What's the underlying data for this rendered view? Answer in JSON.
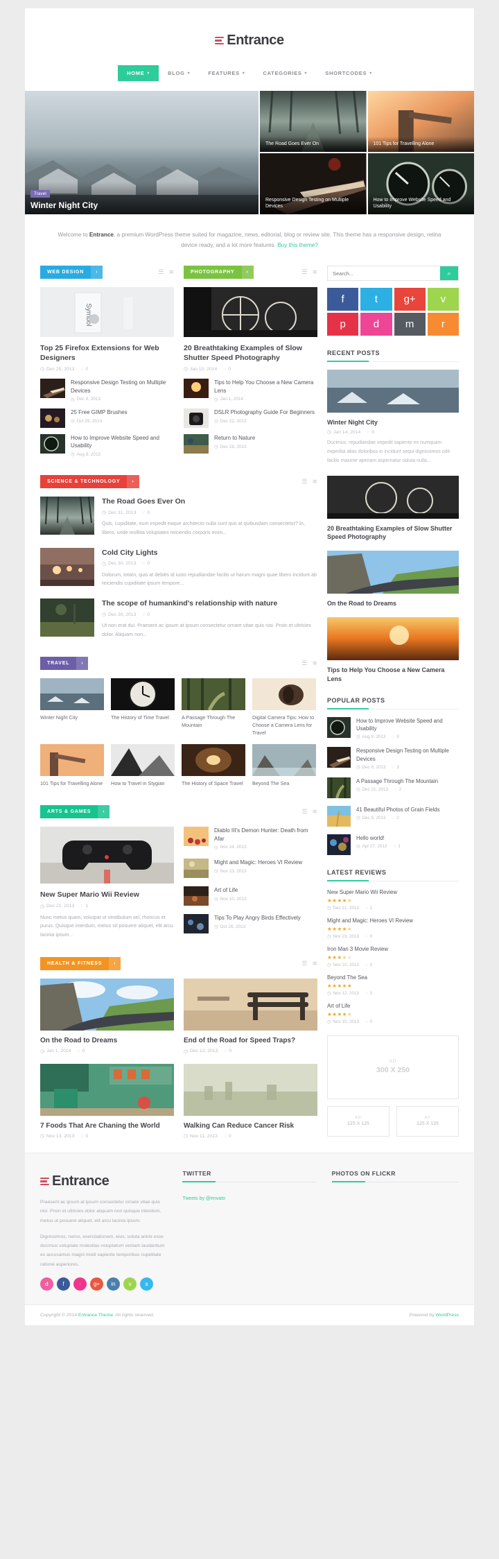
{
  "site": {
    "logo_text": "Entrance",
    "logo_icon": "hamburger-logo-icon"
  },
  "nav": {
    "items": [
      {
        "label": "HOME",
        "caret": "▾",
        "active": true
      },
      {
        "label": "BLOG",
        "caret": "▾",
        "active": false
      },
      {
        "label": "FEATURES",
        "caret": "▾",
        "active": false
      },
      {
        "label": "CATEGORIES",
        "caret": "▾",
        "active": false
      },
      {
        "label": "SHORTCODES",
        "caret": "▾",
        "active": false
      }
    ],
    "active_color": "#2ecc9b"
  },
  "slider": {
    "main": {
      "badge": "Travel",
      "title": "Winter Night City"
    },
    "tiles": [
      {
        "title": "The Road Goes Ever On"
      },
      {
        "title": "101 Tips for Travelling Alone"
      },
      {
        "title": "Responsive Design Testing on Multiple Devices"
      },
      {
        "title": "How to Improve Website Speed and Usability"
      }
    ]
  },
  "welcome": {
    "pre": "Welcome to ",
    "brand": "Entrance",
    "mid": ", a premium WordPress theme suited for magazine, news, editorial, blog or review site. This theme has a responsive design, retina device ready, and a lot more features. ",
    "link": "Buy this theme?"
  },
  "blocks": {
    "web_design": {
      "category": "WEB DESIGN",
      "color": "#29abe2",
      "arrow": "›",
      "feature": {
        "title": "Top 25 Firefox Extensions for Web Designers",
        "date": "Dec 25, 2013",
        "comments": "0"
      },
      "list": [
        {
          "title": "Responsive Design Testing on Multiple Devices",
          "date": "Dec 8, 2013"
        },
        {
          "title": "25 Free GIMP Brushes",
          "date": "Oct 29, 2013"
        },
        {
          "title": "How to Improve Website Speed and Usability",
          "date": "Aug 8, 2013"
        }
      ]
    },
    "photography": {
      "category": "PHOTOGRAPHY",
      "color": "#7cc242",
      "arrow": "›",
      "feature": {
        "title": "20 Breathtaking Examples of Slow Shutter Speed Photography",
        "date": "Jan 10, 2014",
        "comments": "0"
      },
      "list": [
        {
          "title": "Tips to Help You Choose a New Camera Lens",
          "date": "Jan 1, 2014"
        },
        {
          "title": "DSLR Photography Guide For Beginners",
          "date": "Dec 22, 2013"
        },
        {
          "title": "Return to Nature",
          "date": "Dec 18, 2013"
        }
      ]
    },
    "science": {
      "category": "SCIENCE & TECHNOLOGY",
      "color": "#e8413a",
      "arrow": "›",
      "posts": [
        {
          "title": "The Road Goes Ever On",
          "date": "Dec 31, 2013",
          "comments": "0",
          "excerpt": "Quis, cupiditate, eum impedit eaque architecto nulla sunt quo at quibusdam consectetur? In, libero, unde mollitia voluptates reiciendis corporis enim..."
        },
        {
          "title": "Cold City Lights",
          "date": "Dec 30, 2013",
          "comments": "0",
          "excerpt": "Dolorum, totam, quis at debitis id iusto repudiandae facilis ut harum magni quae libero incidunt ab reiciendis cupiditate ipsum tempore..."
        },
        {
          "title": "The scope of humankind's relationship with nature",
          "date": "Dec 30, 2013",
          "comments": "0",
          "excerpt": "Ut non erat dui. Praesent ac ipsum at ipsum consectetur ornare vitae quis nisi. Proin et ultricies dolor. Aliquam non..."
        }
      ]
    },
    "travel": {
      "category": "TRAVEL",
      "color": "#6c5fa8",
      "arrow": "›",
      "items": [
        {
          "title": "Winter Night City"
        },
        {
          "title": "The History of Time Travel"
        },
        {
          "title": "A Passage Through The Mountain"
        },
        {
          "title": "Digital Camera Tips: How to Choose a Camera Lens for Travel"
        },
        {
          "title": "101 Tips for Travelling Alone"
        },
        {
          "title": "How to Travel in Stygian"
        },
        {
          "title": "The History of Space Travel"
        },
        {
          "title": "Beyond The Sea"
        }
      ]
    },
    "arts": {
      "category": "ARTS & GAMES",
      "color": "#17c38f",
      "arrow": "›",
      "feature": {
        "title": "New Super Mario Wii Review",
        "date": "Dec 21, 2013",
        "comments": "1",
        "excerpt": "Nunc metus quam, volutpat ut vestibulum vel, rhoncus et purus. Quisque interdum, metus sit posuere aliquet, elit arcu lacinia ipsum..."
      },
      "list": [
        {
          "title": "Diablo III's Demon Hunter: Death from Afar",
          "date": "Nov 24, 2013"
        },
        {
          "title": "Might and Magic: Heroes VI Review",
          "date": "Nov 23, 2013"
        },
        {
          "title": "Art of Life",
          "date": "Nov 10, 2013"
        },
        {
          "title": "Tips To Play Angry Birds Effectively",
          "date": "Oct 26, 2013"
        }
      ]
    },
    "health": {
      "category": "HEALTH & FITNESS",
      "color": "#f39422",
      "arrow": "›",
      "items": [
        {
          "title": "On the Road to Dreams",
          "date": "Jan 1, 2014",
          "comments": "0"
        },
        {
          "title": "End of the Road for Speed Traps?",
          "date": "Dec 12, 2013",
          "comments": "0"
        },
        {
          "title": "7 Foods That Are Chaning the World",
          "date": "Nov 13, 2013",
          "comments": "0"
        },
        {
          "title": "Walking Can Reduce Cancer Risk",
          "date": "Nov 11, 2013",
          "comments": "0"
        }
      ]
    }
  },
  "sidebar": {
    "search": {
      "placeholder": "Search...",
      "value": "",
      "icon": "search-icon"
    },
    "socials": [
      {
        "name": "facebook-icon",
        "glyph": "f",
        "color": "#3b5a9a"
      },
      {
        "name": "twitter-icon",
        "glyph": "t",
        "color": "#2cafe3"
      },
      {
        "name": "google-plus-icon",
        "glyph": "g+",
        "color": "#e8453c"
      },
      {
        "name": "vimeo-icon",
        "glyph": "v",
        "color": "#9ed54e"
      },
      {
        "name": "pinterest-icon",
        "glyph": "p",
        "color": "#e63249"
      },
      {
        "name": "dribbble-icon",
        "glyph": "d",
        "color": "#ef4596"
      },
      {
        "name": "email-icon",
        "glyph": "m",
        "color": "#555b61"
      },
      {
        "name": "rss-icon",
        "glyph": "r",
        "color": "#f68b31"
      }
    ],
    "recent_posts": {
      "title": "RECENT POSTS",
      "items": [
        {
          "title": "Winter Night City",
          "date": "Jan 14, 2014",
          "comments": "0",
          "excerpt": "Ducimus, repudiandae impedit sapiente ex numquam expedita alias doloribus in incidunt sequi dignissimos odit facilis maxime aperiam aspernatur soluta nulla..."
        },
        {
          "title": "20 Breathtaking Examples of Slow Shutter Speed Photography",
          "date": "",
          "comments": ""
        },
        {
          "title": "On the Road to Dreams",
          "date": "",
          "comments": ""
        },
        {
          "title": "Tips to Help You Choose a New Camera Lens",
          "date": "",
          "comments": ""
        }
      ]
    },
    "popular_posts": {
      "title": "POPULAR POSTS",
      "items": [
        {
          "title": "How to Improve Website Speed and Usability",
          "date": "Aug 8, 2013",
          "comments": "9"
        },
        {
          "title": "Responsive Design Testing on Multiple Devices",
          "date": "Dec 8, 2013",
          "comments": "3"
        },
        {
          "title": "A Passage Through The Mountain",
          "date": "Dec 21, 2013",
          "comments": "2"
        },
        {
          "title": "41 Beautiful Photos of Grain Fields",
          "date": "Dec 8, 2013",
          "comments": "2"
        },
        {
          "title": "Hello world!",
          "date": "Apr 27, 2013",
          "comments": "1"
        }
      ]
    },
    "latest_reviews": {
      "title": "LATEST REVIEWS",
      "items": [
        {
          "title": "New Super Mario Wii Review",
          "rating": 4.5,
          "date": "Dec 21, 2013",
          "comments": "1"
        },
        {
          "title": "Might and Magic: Heroes VI Review",
          "rating": 4.5,
          "date": "Nov 23, 2013",
          "comments": "0"
        },
        {
          "title": "Iron Man 3 Movie Review",
          "rating": 3.5,
          "date": "Nov 22, 2013",
          "comments": "0"
        },
        {
          "title": "Beyond The Sea",
          "rating": 5,
          "date": "Nov 12, 2013",
          "comments": "0"
        },
        {
          "title": "Art of Life",
          "rating": 4.5,
          "date": "Nov 10, 2013",
          "comments": "0"
        }
      ]
    },
    "ads": {
      "big": {
        "label": "AD",
        "size": "300 X 250"
      },
      "small_left": {
        "label": "AD",
        "size": "125 X 125"
      },
      "small_right": {
        "label": "AD",
        "size": "125 X 125"
      }
    }
  },
  "footer": {
    "logo_text": "Entrance",
    "about_p1": "Praesent ac ipsum at ipsum consectetur ornare vitae quis nisi. Proin et ultricies dolor aliquam non quisque interdum, metus ut posuere aliquet, elit arcu lacinia ipsum.",
    "about_p2": "Dignissimos, nemo, exercitationem, eius, soluta animi esse ducimus voluptate molestias voluptatum veniam laudantium ex accusamus magni modi sapiente temporibus cupiditate ratione asperiores.",
    "socials": [
      {
        "name": "dribbble-icon",
        "glyph": "d",
        "color": "#ef5f9e"
      },
      {
        "name": "facebook-icon",
        "glyph": "f",
        "color": "#3b5a9a"
      },
      {
        "name": "flickr-icon",
        "glyph": "·",
        "color": "#f0368c"
      },
      {
        "name": "google-plus-icon",
        "glyph": "g+",
        "color": "#e8573f"
      },
      {
        "name": "linkedin-icon",
        "glyph": "in",
        "color": "#4a7fae"
      },
      {
        "name": "vimeo-icon",
        "glyph": "v",
        "color": "#9ed54e"
      },
      {
        "name": "skype-icon",
        "glyph": "s",
        "color": "#35b9ec"
      }
    ],
    "twitter": {
      "title": "TWITTER",
      "link": "Tweets by @envato"
    },
    "flickr": {
      "title": "PHOTOS ON FLICKR"
    },
    "copyright_pre": "Copyright © 2014 ",
    "copyright_link": "Entrance Theme",
    "copyright_post": ". All rights reserved.",
    "powered_pre": "Powered by ",
    "powered_link": "WordPress"
  },
  "icons": {
    "clock": "◷",
    "comment": "💬",
    "list": "☰",
    "rss": "≈",
    "arrow": "›"
  }
}
